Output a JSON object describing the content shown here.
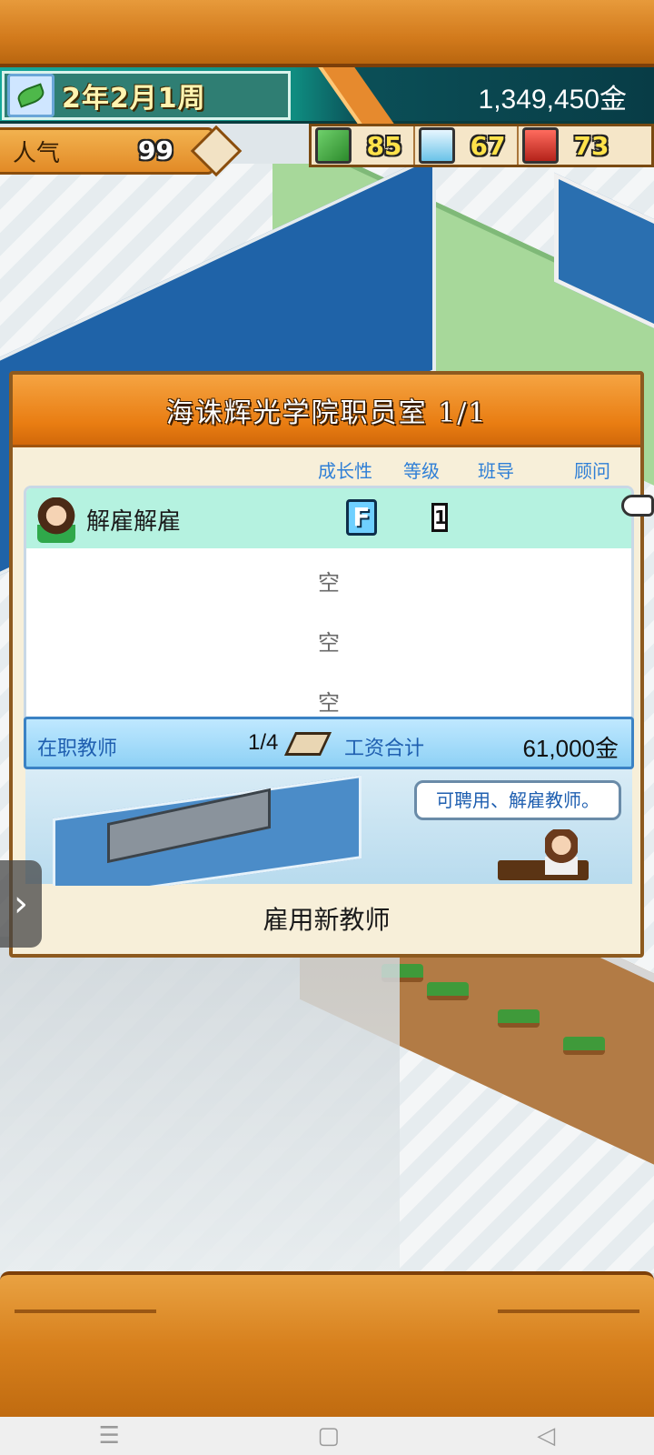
{
  "status": {
    "date": "2年2月1周",
    "money": "1,349,450金"
  },
  "popularity": {
    "label": "人气",
    "value": "99"
  },
  "stats": [
    {
      "icon": "pencil-icon",
      "value": "85"
    },
    {
      "icon": "flask-icon",
      "value": "67"
    },
    {
      "icon": "book-icon",
      "value": "73"
    }
  ],
  "dialog": {
    "title": "海诛辉光学院职员室 1/1",
    "columns": {
      "growth": "成长性",
      "level": "等级",
      "homeroom": "班导",
      "advisor": "顾问"
    },
    "staff": [
      {
        "name": "解雇解雇",
        "grade": "F",
        "level": "1"
      }
    ],
    "empty_label": "空",
    "summary": {
      "active_label": "在职教师",
      "count": "1/4",
      "wage_label": "工资合计",
      "wage_total": "61,000金"
    },
    "hint": "可聘用、解雇教师。",
    "hire_button": "雇用新教师"
  },
  "colors": {
    "header_orange": "#e97d12",
    "row_highlight": "#b5f2e0",
    "accent_blue": "#2f7fd6"
  }
}
